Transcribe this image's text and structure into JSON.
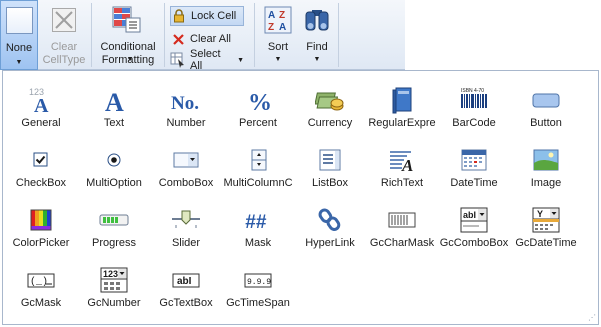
{
  "ribbon": {
    "none": {
      "label": "None",
      "icon": "empty-cell-icon"
    },
    "clear_celltype": {
      "label_line1": "Clear",
      "label_line2": "CellType",
      "icon": "clear-celltype-icon",
      "enabled": false
    },
    "conditional_formatting": {
      "label_line1": "Conditional",
      "label_line2": "Formatting",
      "icon": "conditional-formatting-icon"
    },
    "lock_cell": {
      "label": "Lock Cell",
      "icon": "lock-icon",
      "active": true
    },
    "clear_all": {
      "label": "Clear All",
      "icon": "red-x-icon"
    },
    "select_all": {
      "label": "Select All",
      "icon": "select-all-icon"
    },
    "sort": {
      "label": "Sort",
      "icon": "sort-az-icon"
    },
    "find": {
      "label": "Find",
      "icon": "binoculars-icon"
    }
  },
  "gallery": {
    "items": [
      {
        "label": "General",
        "icon": "general-123-icon"
      },
      {
        "label": "Text",
        "icon": "text-a-icon"
      },
      {
        "label": "Number",
        "icon": "number-no-icon"
      },
      {
        "label": "Percent",
        "icon": "percent-icon"
      },
      {
        "label": "Currency",
        "icon": "currency-coins-icon"
      },
      {
        "label": "RegularExpre",
        "icon": "book-icon"
      },
      {
        "label": "BarCode",
        "icon": "barcode-icon"
      },
      {
        "label": "Button",
        "icon": "button-icon"
      },
      {
        "label": "CheckBox",
        "icon": "checkbox-icon"
      },
      {
        "label": "MultiOption",
        "icon": "radio-icon"
      },
      {
        "label": "ComboBox",
        "icon": "combobox-icon"
      },
      {
        "label": "MultiColumnC",
        "icon": "multicolumn-combo-icon"
      },
      {
        "label": "ListBox",
        "icon": "listbox-icon"
      },
      {
        "label": "RichText",
        "icon": "richtext-icon"
      },
      {
        "label": "DateTime",
        "icon": "calendar-icon"
      },
      {
        "label": "Image",
        "icon": "image-icon"
      },
      {
        "label": "ColorPicker",
        "icon": "colorpicker-icon"
      },
      {
        "label": "Progress",
        "icon": "progress-icon"
      },
      {
        "label": "Slider",
        "icon": "slider-icon"
      },
      {
        "label": "Mask",
        "icon": "mask-hash-icon"
      },
      {
        "label": "HyperLink",
        "icon": "hyperlink-icon"
      },
      {
        "label": "GcCharMask",
        "icon": "gccharmask-icon"
      },
      {
        "label": "GcComboBox",
        "icon": "gccombobox-icon"
      },
      {
        "label": "GcDateTime",
        "icon": "gcdatetime-icon"
      },
      {
        "label": "GcMask",
        "icon": "gcmask-icon"
      },
      {
        "label": "GcNumber",
        "icon": "gcnumber-icon"
      },
      {
        "label": "GcTextBox",
        "icon": "gctextbox-icon"
      },
      {
        "label": "GcTimeSpan",
        "icon": "gctimespan-icon"
      }
    ],
    "icon_text": {
      "general": "123",
      "text": "A",
      "number": "No.",
      "percent": "%",
      "mask": "##",
      "gcnumber": "123",
      "gccombobox": "abI",
      "gcdatetime": "Y",
      "gctextbox": "abI",
      "gctimespan": "9.9.9",
      "barcode": "ISBN 4-70"
    }
  }
}
